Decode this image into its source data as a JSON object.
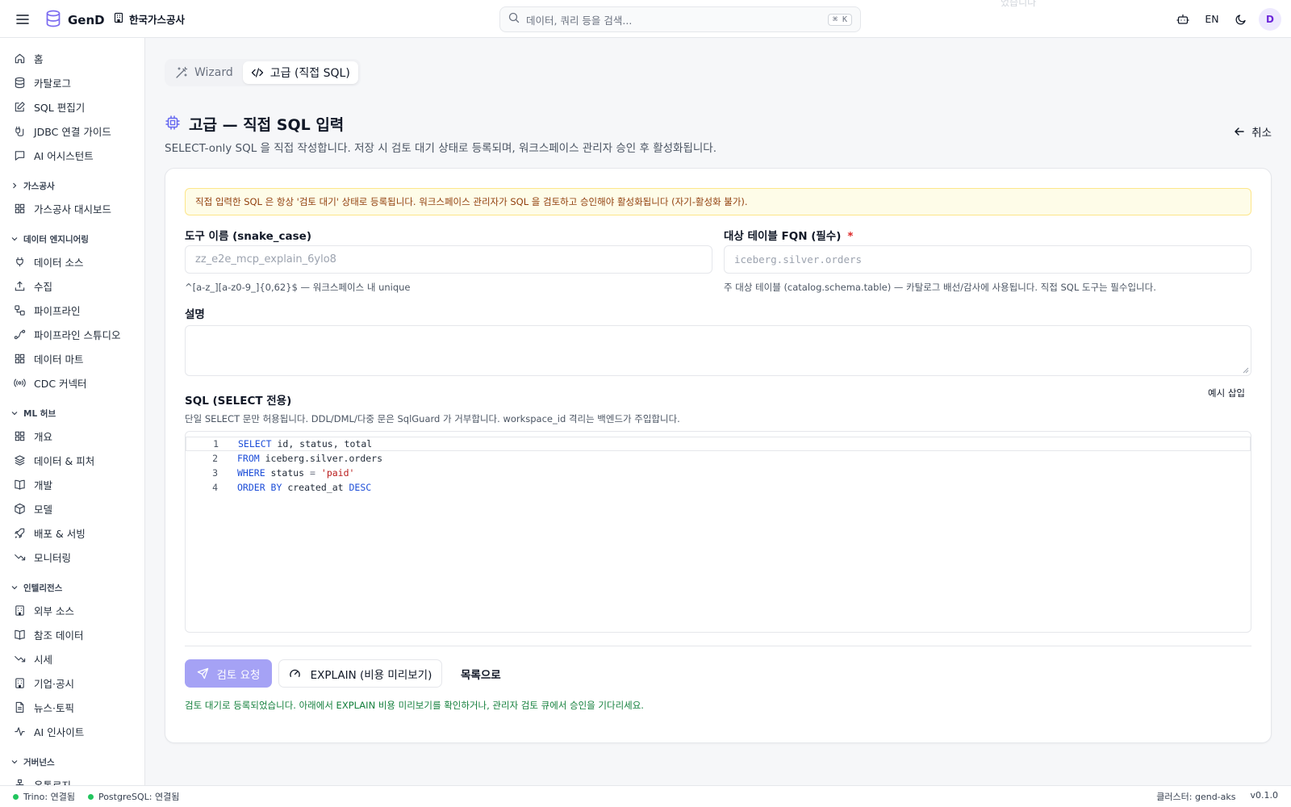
{
  "header": {
    "brand": "GenD",
    "org": "한국가스공사",
    "search_placeholder": "데이터, 쿼리 등을 검색...",
    "search_kbd": "⌘ K",
    "faint_toast": "었습니다",
    "lang": "EN",
    "avatar": "D"
  },
  "sidebar": {
    "top_items": [
      "홈",
      "카탈로그",
      "SQL 편집기",
      "JDBC 연결 가이드",
      "AI 어시스턴트"
    ],
    "groups": [
      {
        "label": "가스공사",
        "items": [
          "가스공사 대시보드"
        ]
      },
      {
        "label": "데이터 엔지니어링",
        "items": [
          "데이터 소스",
          "수집",
          "파이프라인",
          "파이프라인 스튜디오",
          "데이터 마트",
          "CDC 커넥터"
        ]
      },
      {
        "label": "ML 허브",
        "items": [
          "개요",
          "데이터 & 피처",
          "개발",
          "모델",
          "배포 & 서빙",
          "모니터링"
        ]
      },
      {
        "label": "인텔리전스",
        "items": [
          "외부 소스",
          "참조 데이터",
          "시세",
          "기업·공시",
          "뉴스·토픽",
          "AI 인사이트"
        ]
      },
      {
        "label": "거버넌스",
        "items": [
          "온톨로지"
        ]
      }
    ]
  },
  "tabs": {
    "wizard": "Wizard",
    "advanced": "고급 (직접 SQL)"
  },
  "page": {
    "title": "고급 — 직접 SQL 입력",
    "subtitle": "SELECT-only SQL 을 직접 작성합니다. 저장 시 검토 대기 상태로 등록되며, 워크스페이스 관리자 승인 후 활성화됩니다.",
    "cancel": "취소"
  },
  "form": {
    "warning": "직접 입력한 SQL 은 항상 '검토 대기' 상태로 등록됩니다. 워크스페이스 관리자가 SQL 을 검토하고 승인해야 활성화됩니다 (자기-활성화 불가).",
    "tool_name_label": "도구 이름 (snake_case)",
    "tool_name_placeholder": "zz_e2e_mcp_explain_6ylo8",
    "tool_name_hint": "^[a-z_][a-z0-9_]{0,62}$ — 워크스페이스 내 unique",
    "fqn_label": "대상 테이블 FQN (필수)",
    "fqn_required": "*",
    "fqn_placeholder": "iceberg.silver.orders",
    "fqn_hint": "주 대상 테이블 (catalog.schema.table) — 카탈로그 배선/감사에 사용됩니다. 직접 SQL 도구는 필수입니다.",
    "desc_label": "설명",
    "sql_label": "SQL (SELECT 전용)",
    "sql_hint": "단일 SELECT 문만 허용됩니다. DDL/DML/다중 문은 SqlGuard 가 거부합니다. workspace_id 격리는 백엔드가 주입합니다.",
    "example_insert": "예시 삽입",
    "sql_lines": [
      "1",
      "2",
      "3",
      "4"
    ],
    "submit": "검토 요청",
    "explain": "EXPLAIN (비용 미리보기)",
    "back": "목록으로",
    "success": "검토 대기로 등록되었습니다. 아래에서 EXPLAIN 비용 미리보기를 확인하거나, 관리자 검토 큐에서 승인을 기다리세요."
  },
  "sql": {
    "l1_kw": "SELECT",
    "l1_rest": " id, status, total",
    "l2_kw": "FROM",
    "l2_rest": " iceberg.silver.orders",
    "l3_kw": "WHERE",
    "l3_mid": " status ",
    "l3_op": "=",
    "l3_sp": " ",
    "l3_str": "'paid'",
    "l4_kw": "ORDER BY",
    "l4_mid": " created_at ",
    "l4_kw2": "DESC"
  },
  "statusbar": {
    "trino": "Trino: 연결됨",
    "postgres": "PostgreSQL: 연결됨",
    "cluster": "클러스터: gend-aks",
    "version": "v0.1.0"
  },
  "colors": {
    "accent": "#6366f1",
    "primary_btn": "#a5a2f5",
    "success": "#15803d",
    "warning_text": "#92400e"
  }
}
